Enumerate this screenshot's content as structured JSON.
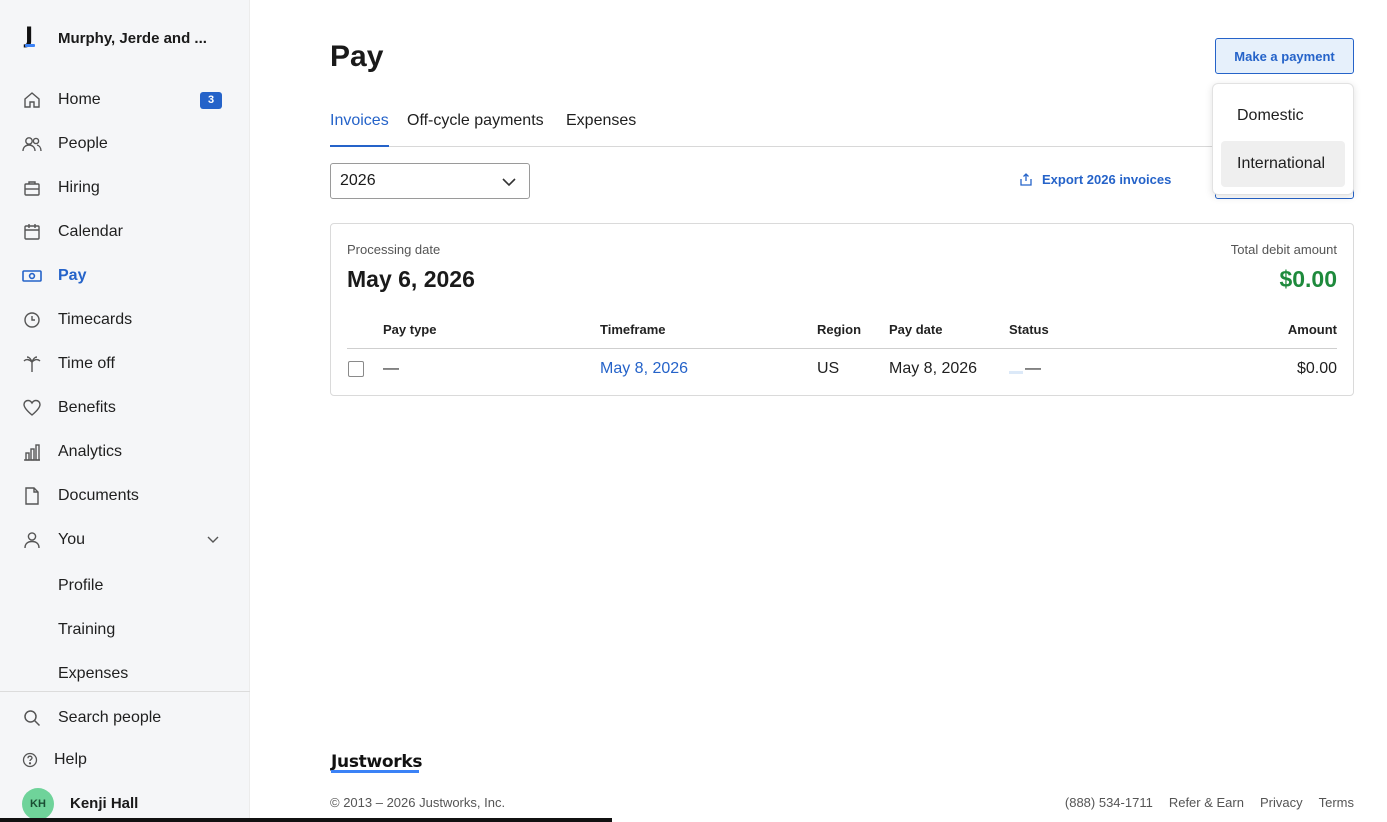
{
  "brand": {
    "logo_letter": "J",
    "company_name": "Murphy, Jerde and ..."
  },
  "sidebar": {
    "items": [
      {
        "label": "Home",
        "icon": "home-icon",
        "badge": "3"
      },
      {
        "label": "People",
        "icon": "people-icon"
      },
      {
        "label": "Hiring",
        "icon": "briefcase-icon"
      },
      {
        "label": "Calendar",
        "icon": "calendar-icon"
      },
      {
        "label": "Pay",
        "icon": "money-icon",
        "active": true
      },
      {
        "label": "Timecards",
        "icon": "clock-icon"
      },
      {
        "label": "Time off",
        "icon": "palm-tree-icon"
      },
      {
        "label": "Benefits",
        "icon": "heart-icon"
      },
      {
        "label": "Analytics",
        "icon": "bar-chart-icon"
      },
      {
        "label": "Documents",
        "icon": "document-icon"
      },
      {
        "label": "You",
        "icon": "user-icon"
      }
    ],
    "sub_items": [
      "Profile",
      "Training",
      "Expenses"
    ],
    "search_label": "Search people",
    "help_label": "Help",
    "user": {
      "initials": "KH",
      "name": "Kenji Hall"
    }
  },
  "page": {
    "title": "Pay",
    "make_payment_label": "Make a payment",
    "tabs": [
      "Invoices",
      "Off-cycle payments",
      "Expenses"
    ],
    "active_tab": "Invoices",
    "year_select": "2026",
    "export_label": "Export 2026 invoices"
  },
  "dropdown": {
    "items": [
      "Domestic",
      "International"
    ]
  },
  "invoice": {
    "processing_label": "Processing date",
    "processing_date": "May 6, 2026",
    "debit_label": "Total debit amount",
    "debit_amount": "$0.00",
    "columns": [
      "Pay type",
      "Timeframe",
      "Region",
      "Pay date",
      "Status",
      "Amount"
    ],
    "row": {
      "pay_type": "—",
      "timeframe": "May 8, 2026",
      "region": "US",
      "pay_date": "May 8, 2026",
      "status": "—",
      "amount": "$0.00"
    }
  },
  "footer": {
    "logo": "Justworks",
    "copyright": "© 2013 – 2026 Justworks, Inc.",
    "phone": "(888) 534-1711",
    "links": [
      "Refer & Earn",
      "Privacy",
      "Terms"
    ]
  },
  "colors": {
    "accent": "#2563c9",
    "positive": "#1e8a3c",
    "avatar": "#6fd39a"
  }
}
